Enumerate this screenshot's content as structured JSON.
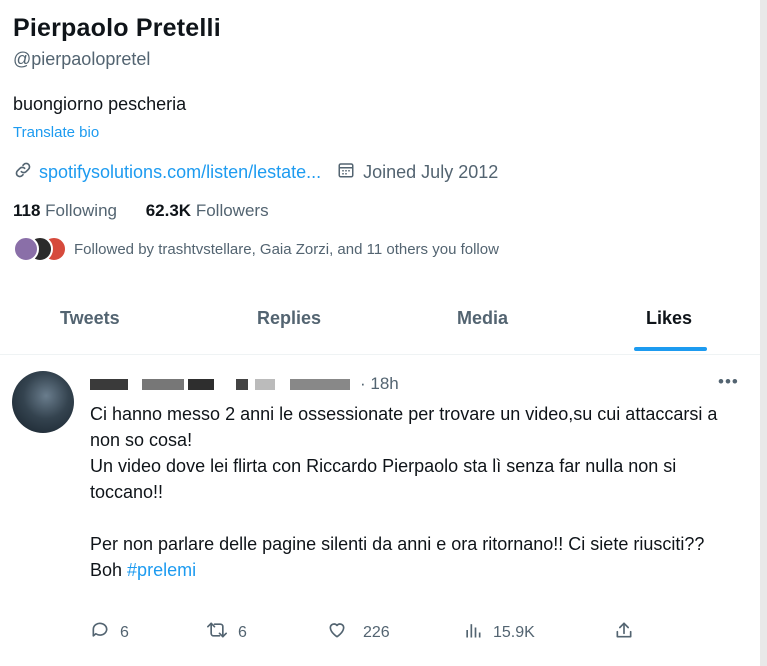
{
  "profile": {
    "name": "Pierpaolo Pretelli",
    "handle": "@pierpaolopretel",
    "bio": "buongiorno pescheria",
    "translate_label": "Translate bio",
    "link": "spotifysolutions.com/listen/lestate...",
    "joined": "Joined July 2012",
    "following_count": "118",
    "following_label": "Following",
    "followers_count": "62.3K",
    "followers_label": "Followers",
    "followed_by": "Followed by trashtvstellare, Gaia Zorzi, and 11 others you follow"
  },
  "tabs": [
    {
      "label": "Tweets"
    },
    {
      "label": "Replies"
    },
    {
      "label": "Media"
    },
    {
      "label": "Likes",
      "active": true
    }
  ],
  "tweet": {
    "time": "· 18h",
    "lines": [
      "Ci hanno messo 2 anni le ossessionate per trovare un video,su cui attaccarsi a non so cosa!",
      "Un video dove lei flirta con Riccardo Pierpaolo sta lì senza far nulla non si toccano!!",
      "Per non parlare delle pagine silenti da anni e ora ritornano!! Ci siete riusciti??"
    ],
    "last_prefix": "Boh",
    "hashtag": "#prelemi",
    "replies": "6",
    "retweets": "6",
    "likes": "226",
    "views": "15.9K"
  },
  "icons": [
    "link-icon",
    "calendar-icon",
    "more-icon",
    "reply-icon",
    "retweet-icon",
    "like-icon",
    "views-icon",
    "share-icon"
  ],
  "colors": {
    "accent": "#1d9bf0",
    "secondary": "#536471",
    "text": "#0f1419"
  }
}
